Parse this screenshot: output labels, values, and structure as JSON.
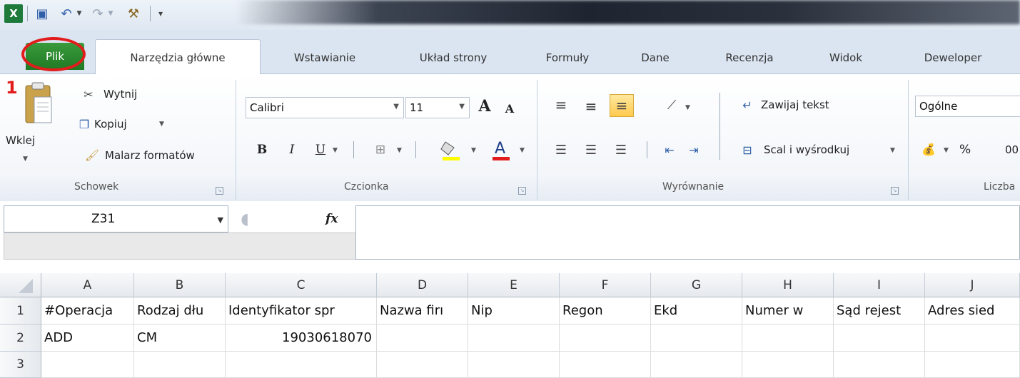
{
  "tabs": {
    "file": "Plik",
    "home": "Narzędzia główne",
    "insert": "Wstawianie",
    "page_layout": "Układ strony",
    "formulas": "Formuły",
    "data": "Dane",
    "review": "Recenzja",
    "view": "Widok",
    "developer": "Deweloper"
  },
  "annotation_number": "1",
  "clipboard": {
    "paste": "Wklej",
    "cut": "Wytnij",
    "copy": "Kopiuj",
    "format_painter": "Malarz formatów",
    "group_label": "Schowek"
  },
  "font": {
    "font_name": "Calibri",
    "font_size": "11",
    "bold": "B",
    "italic": "I",
    "underline": "U",
    "group_label": "Czcionka"
  },
  "alignment": {
    "wrap_text": "Zawijaj tekst",
    "merge_center": "Scal i wyśrodkuj",
    "group_label": "Wyrównanie"
  },
  "number": {
    "format": "Ogólne",
    "percent": "%",
    "comma": "00",
    "group_label": "Liczba"
  },
  "formula_bar": {
    "name_box": "Z31",
    "fx": "fx",
    "formula": ""
  },
  "grid": {
    "columns": [
      "A",
      "B",
      "C",
      "D",
      "E",
      "F",
      "G",
      "H",
      "I",
      "J"
    ],
    "rows": [
      "1",
      "2",
      "3"
    ],
    "row1": [
      "#Operacja",
      "Rodzaj dłu",
      "Identyfikator spr",
      "Nazwa firı",
      "Nip",
      "Regon",
      "Ekd",
      "Numer w",
      "Sąd rejest",
      "Adres sied"
    ],
    "row2": [
      "ADD",
      "CM",
      "19030618070",
      "",
      "",
      "",
      "",
      "",
      "",
      ""
    ],
    "row3": [
      "",
      "",
      "",
      "",
      "",
      "",
      "",
      "",
      "",
      ""
    ]
  },
  "colors": {
    "file_tab": "#2a8a2e",
    "annotation_red": "#e21c1c",
    "ribbon_bg": "#dbe5f1"
  }
}
